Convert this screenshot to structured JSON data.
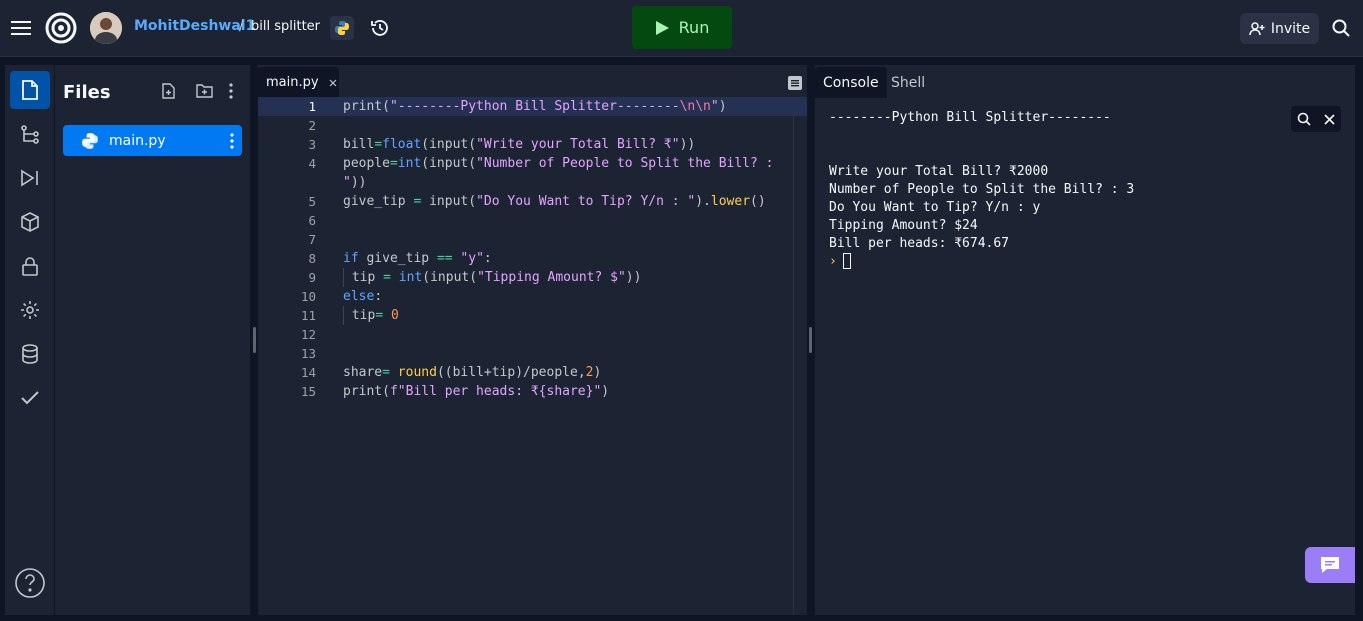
{
  "header": {
    "username": "MohitDeshwal1",
    "separator": "/",
    "repl_name": "bill splitter",
    "run_label": "Run",
    "invite_label": "Invite"
  },
  "files": {
    "title": "Files",
    "items": [
      {
        "name": "main.py"
      }
    ]
  },
  "editor": {
    "tab_label": "main.py",
    "lines": [
      {
        "n": "1"
      },
      {
        "n": "2"
      },
      {
        "n": "3"
      },
      {
        "n": "4"
      },
      {
        "n": ""
      },
      {
        "n": "5"
      },
      {
        "n": "6"
      },
      {
        "n": "7"
      },
      {
        "n": "8"
      },
      {
        "n": "9"
      },
      {
        "n": "10"
      },
      {
        "n": "11"
      },
      {
        "n": "12"
      },
      {
        "n": "13"
      },
      {
        "n": "14"
      },
      {
        "n": "15"
      }
    ],
    "code": {
      "l1_fn": "print",
      "l1_a": "(",
      "l1_s": "\"--------Python Bill Splitter--------",
      "l1_e": "\\n\\n",
      "l1_q": "\"",
      "l1_b": ")",
      "l3_a": "bill",
      "l3_op": "=",
      "l3_fn": "float",
      "l3_b": "(input(",
      "l3_s": "\"Write your Total Bill? ₹\"",
      "l3_c": "))",
      "l4_a": "people",
      "l4_op": "=",
      "l4_fn": "int",
      "l4_b": "(input(",
      "l4_s": "\"Number of People to Split the Bill? :",
      "l4w_s": "\"",
      "l4w_c": "))",
      "l5_a": "give_tip ",
      "l5_op": "=",
      "l5_b": " input(",
      "l5_s": "\"Do You Want to Tip? Y/n : \"",
      "l5_c": ").",
      "l5_fn": "lower",
      "l5_d": "()",
      "l8_kw": "if",
      "l8_a": " give_tip ",
      "l8_op": "==",
      "l8_sp": " ",
      "l8_s": "\"y\"",
      "l8_c": ":",
      "l9_a": " tip ",
      "l9_op": "=",
      "l9_sp": " ",
      "l9_fn": "int",
      "l9_b": "(input(",
      "l9_s": "\"Tipping Amount? $\"",
      "l9_c": "))",
      "l10_kw": "else",
      "l10_c": ":",
      "l11_a": " tip",
      "l11_op": "=",
      "l11_sp": " ",
      "l11_n": "0",
      "l14_a": "share",
      "l14_op": "=",
      "l14_sp": " ",
      "l14_fn": "round",
      "l14_b": "((bill+tip)/people,",
      "l14_n": "2",
      "l14_c": ")",
      "l15_fn": "print",
      "l15_a": "(",
      "l15_s": "f\"Bill per heads: ₹{share}\"",
      "l15_b": ")"
    }
  },
  "console": {
    "tabs": [
      "Console",
      "Shell"
    ],
    "output": "--------Python Bill Splitter--------\n\n\nWrite your Total Bill? ₹2000\nNumber of People to Split the Bill? : 3\nDo You Want to Tip? Y/n : y\nTipping Amount? $24\nBill per heads: ₹674.67",
    "prompt": "›"
  },
  "colors": {
    "accent": "#0079f2",
    "run_bg": "#044a10",
    "run_text": "#a9f5b4",
    "username": "#57abff",
    "chat": "#9a7df7"
  }
}
